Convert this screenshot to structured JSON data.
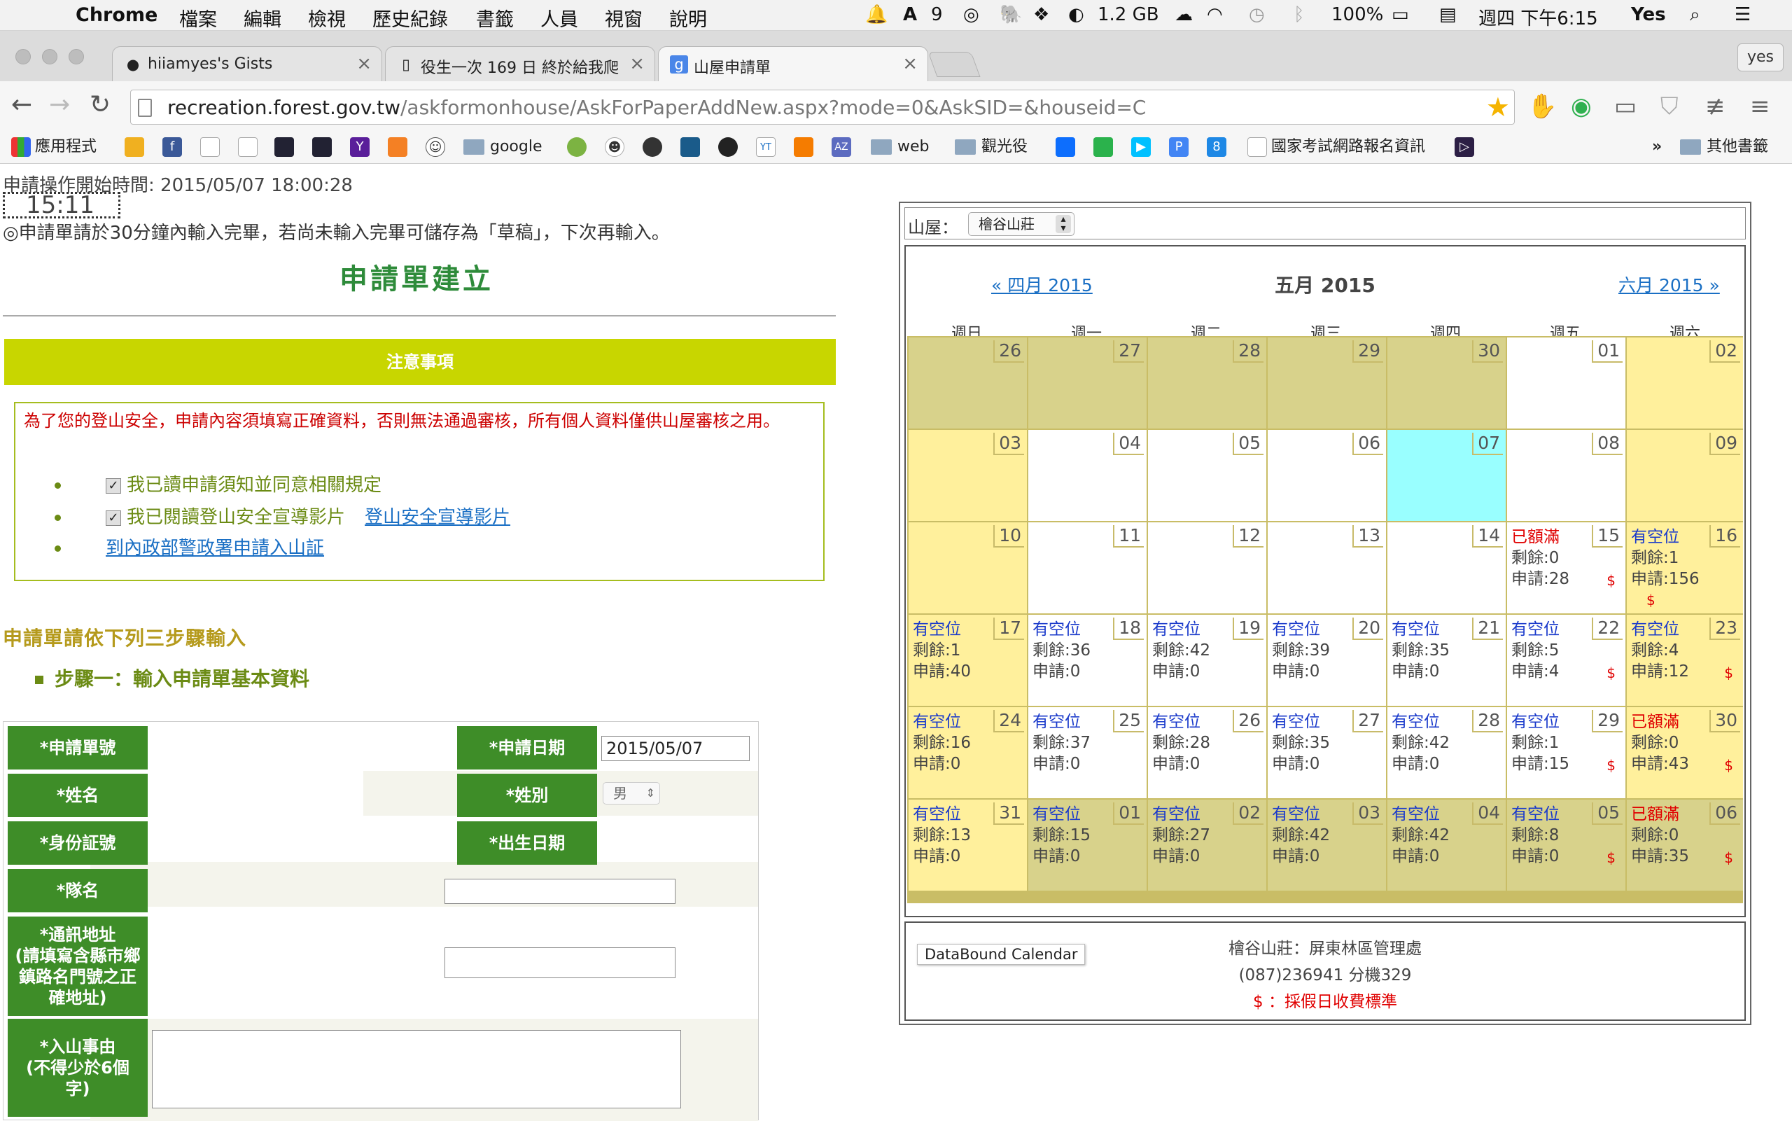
{
  "os_menubar": {
    "app_name": "Chrome",
    "menus": [
      "檔案",
      "編輯",
      "檢視",
      "歷史紀錄",
      "書籤",
      "人員",
      "視窗",
      "說明"
    ],
    "status": {
      "notif_count": "9",
      "memory": "1.2 GB",
      "battery": "100%",
      "datetime": "週四 下午6:15",
      "user": "Yes"
    }
  },
  "tabs": [
    {
      "title": "hiiamyes's Gists",
      "icon": "github-icon"
    },
    {
      "title": "役生一次 169 日 終於給我爬",
      "icon": "page-icon"
    },
    {
      "title": "山屋申請單",
      "icon": "google-icon",
      "active": true
    }
  ],
  "profile_button": "yes",
  "address": {
    "host": "recreation.forest.gov.tw",
    "path": "/askformonhouse/AskForPaperAddNew.aspx?mode=0&AskSID=&houseid=C"
  },
  "bookmarks": {
    "apps": "應用程式",
    "google": "google",
    "web": "web",
    "tour": "觀光役",
    "exam": "國家考試網路報名資訊",
    "more": "»",
    "other": "其他書籤",
    "icon_labels": {
      "yahoo": "Y",
      "az": "AZ",
      "p": "P",
      "eight": "8",
      "yt": "YT"
    }
  },
  "form": {
    "start_time_label": "申請操作開始時間: 2015/05/07 18:00:28",
    "timer": "15:11",
    "notice_30min": "◎申請單請於30分鐘內輸入完畢，若尚未輸入完畢可儲存為「草稿」，下次再輸入。",
    "title": "申請單建立",
    "notice_bar": "注意事項",
    "warning": "為了您的登山安全，申請內容須填寫正確資料，否則無法通過審核，所有個人資料僅供山屋審核之用。",
    "check1": "我已讀申請須知並同意相關規定",
    "check2": "我已閱讀登山安全宣導影片",
    "check2_link": "登山安全宣導影片",
    "mountain_link": "到內政部警政署申請入山証",
    "steps_heading": "申請單請依下列三步驟輸入",
    "step1": "步驟一：輸入申請單基本資料",
    "fields": {
      "app_no": "*申請單號",
      "app_date": "*申請日期",
      "app_date_value": "2015/05/07",
      "name": "*姓名",
      "gender": "*姓別",
      "gender_value": "男",
      "id_no": "*身份証號",
      "birth": "*出生日期",
      "team": "*隊名",
      "address": "*通訊地址\n(請填寫含縣市鄉鎮路名門號之正確地址)",
      "reason": "*入山事由\n(不得少於6個字)"
    }
  },
  "calendar": {
    "house_label": "山屋：",
    "house_value": "檜谷山莊",
    "prev": "« 四月 2015",
    "current": "五月 2015",
    "next": "六月 2015 »",
    "weekdays": [
      "週日",
      "週一",
      "週二",
      "週三",
      "週四",
      "週五",
      "週六"
    ],
    "rows": [
      [
        {
          "d": "26",
          "t": "o"
        },
        {
          "d": "27",
          "t": "o"
        },
        {
          "d": "28",
          "t": "o"
        },
        {
          "d": "29",
          "t": "o"
        },
        {
          "d": "30",
          "t": "o"
        },
        {
          "d": "01",
          "t": "w"
        },
        {
          "d": "02",
          "t": "h"
        }
      ],
      [
        {
          "d": "03",
          "t": "h"
        },
        {
          "d": "04",
          "t": "w"
        },
        {
          "d": "05",
          "t": "w"
        },
        {
          "d": "06",
          "t": "w"
        },
        {
          "d": "07",
          "t": "today"
        },
        {
          "d": "08",
          "t": "w"
        },
        {
          "d": "09",
          "t": "h"
        }
      ],
      [
        {
          "d": "10",
          "t": "h"
        },
        {
          "d": "11",
          "t": "w"
        },
        {
          "d": "12",
          "t": "w"
        },
        {
          "d": "13",
          "t": "w"
        },
        {
          "d": "14",
          "t": "w"
        },
        {
          "d": "15",
          "t": "w",
          "status": "已額滿",
          "full": true,
          "remain": "剩餘:0",
          "applied": "申請:28",
          "fee": "$"
        },
        {
          "d": "16",
          "t": "h",
          "status": "有空位",
          "remain": "剩餘:1",
          "applied": "申請:156",
          "fee": "$",
          "fee_below": true
        }
      ],
      [
        {
          "d": "17",
          "t": "h",
          "status": "有空位",
          "remain": "剩餘:1",
          "applied": "申請:40"
        },
        {
          "d": "18",
          "t": "w",
          "status": "有空位",
          "remain": "剩餘:36",
          "applied": "申請:0"
        },
        {
          "d": "19",
          "t": "w",
          "status": "有空位",
          "remain": "剩餘:42",
          "applied": "申請:0"
        },
        {
          "d": "20",
          "t": "w",
          "status": "有空位",
          "remain": "剩餘:39",
          "applied": "申請:0"
        },
        {
          "d": "21",
          "t": "w",
          "status": "有空位",
          "remain": "剩餘:35",
          "applied": "申請:0"
        },
        {
          "d": "22",
          "t": "w",
          "status": "有空位",
          "remain": "剩餘:5",
          "applied": "申請:4",
          "fee": "$"
        },
        {
          "d": "23",
          "t": "h",
          "status": "有空位",
          "remain": "剩餘:4",
          "applied": "申請:12",
          "fee": "$"
        }
      ],
      [
        {
          "d": "24",
          "t": "h",
          "status": "有空位",
          "remain": "剩餘:16",
          "applied": "申請:0"
        },
        {
          "d": "25",
          "t": "w",
          "status": "有空位",
          "remain": "剩餘:37",
          "applied": "申請:0"
        },
        {
          "d": "26",
          "t": "w",
          "status": "有空位",
          "remain": "剩餘:28",
          "applied": "申請:0"
        },
        {
          "d": "27",
          "t": "w",
          "status": "有空位",
          "remain": "剩餘:35",
          "applied": "申請:0"
        },
        {
          "d": "28",
          "t": "w",
          "status": "有空位",
          "remain": "剩餘:42",
          "applied": "申請:0"
        },
        {
          "d": "29",
          "t": "w",
          "status": "有空位",
          "remain": "剩餘:1",
          "applied": "申請:15",
          "fee": "$"
        },
        {
          "d": "30",
          "t": "h",
          "status": "已額滿",
          "full": true,
          "remain": "剩餘:0",
          "applied": "申請:43",
          "fee": "$"
        }
      ],
      [
        {
          "d": "31",
          "t": "h",
          "status": "有空位",
          "remain": "剩餘:13",
          "applied": "申請:0"
        },
        {
          "d": "01",
          "t": "o",
          "status": "有空位",
          "remain": "剩餘:15",
          "applied": "申請:0"
        },
        {
          "d": "02",
          "t": "o",
          "status": "有空位",
          "remain": "剩餘:27",
          "applied": "申請:0"
        },
        {
          "d": "03",
          "t": "o",
          "status": "有空位",
          "remain": "剩餘:42",
          "applied": "申請:0"
        },
        {
          "d": "04",
          "t": "o",
          "status": "有空位",
          "remain": "剩餘:42",
          "applied": "申請:0"
        },
        {
          "d": "05",
          "t": "o",
          "status": "有空位",
          "remain": "剩餘:8",
          "applied": "申請:0",
          "fee": "$"
        },
        {
          "d": "06",
          "t": "o",
          "status": "已額滿",
          "full": true,
          "remain": "剩餘:0",
          "applied": "申請:35",
          "fee": "$"
        }
      ]
    ],
    "tooltip": "DataBound Calendar",
    "info_line1": "檜谷山莊：屏東林區管理處",
    "info_line2": "(087)236941 分機329",
    "info_line3": "$ ：採假日收費標準"
  },
  "colors": {
    "weekday": "#ffffff",
    "holiday": "#fff09c",
    "other_month": "#d8d28b",
    "today": "#99ffff",
    "green": "#3e8d28",
    "accent": "#c8d600"
  }
}
